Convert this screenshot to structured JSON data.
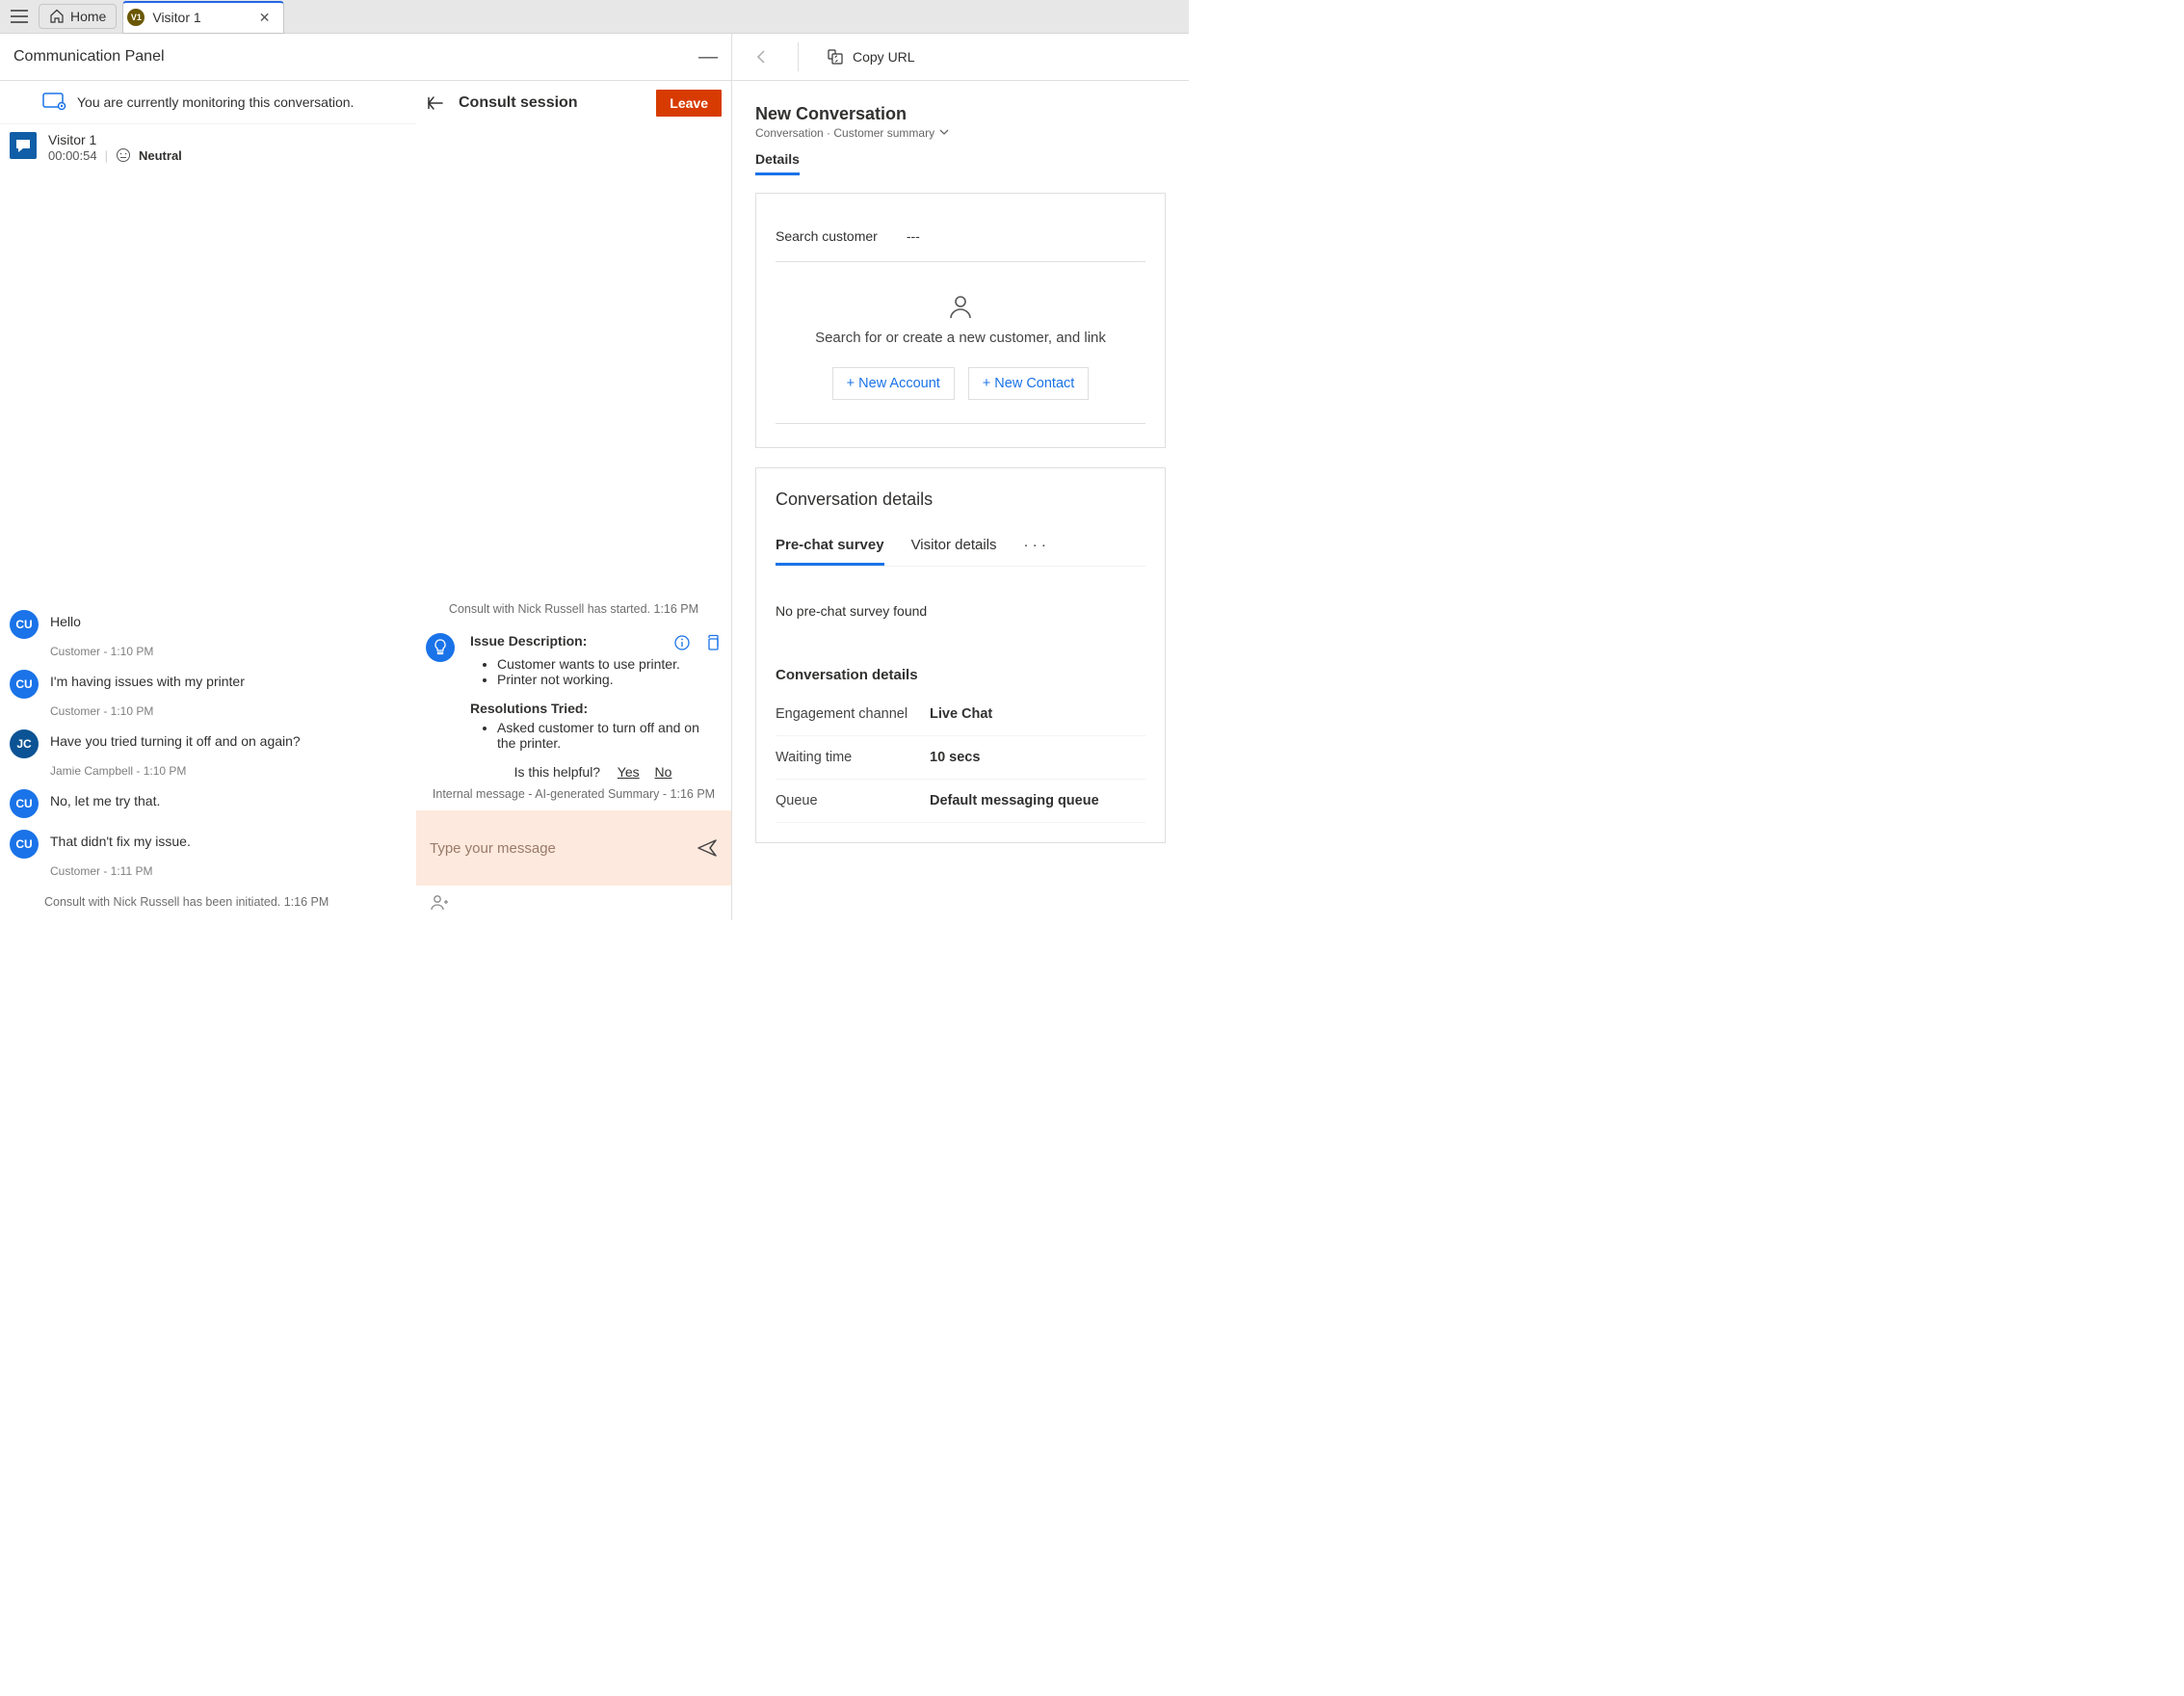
{
  "top": {
    "home_label": "Home",
    "tab_label": "Visitor 1",
    "tab_badge": "V1"
  },
  "comm": {
    "title": "Communication Panel",
    "monitor_msg": "You are currently monitoring this conversation.",
    "consult_title": "Consult session",
    "leave_label": "Leave"
  },
  "session": {
    "name": "Visitor 1",
    "timer": "00:00:54",
    "sentiment": "Neutral"
  },
  "chat": {
    "messages": [
      {
        "avatar": "CU",
        "text": "Hello",
        "meta": "Customer - 1:10 PM"
      },
      {
        "avatar": "CU",
        "text": "I'm having issues with my printer",
        "meta": "Customer - 1:10 PM"
      },
      {
        "avatar": "JC",
        "text": "Have you tried turning it off and on again?",
        "meta": "Jamie Campbell - 1:10 PM"
      },
      {
        "avatar": "CU",
        "text": "No, let me try that.",
        "meta": ""
      },
      {
        "avatar": "CU",
        "text": "That didn't fix my issue.",
        "meta": "Customer - 1:11 PM"
      }
    ],
    "system": "Consult with Nick Russell has been initiated. 1:16 PM"
  },
  "consult": {
    "system_top": "Consult with Nick Russell has started. 1:16 PM",
    "issue_h": "Issue Description:",
    "issues": [
      "Customer wants to use printer.",
      "Printer not working."
    ],
    "res_h": "Resolutions Tried:",
    "resolutions": [
      "Asked customer to turn off and on the printer."
    ],
    "helpful_q": "Is this helpful?",
    "yes": "Yes",
    "no": "No",
    "internal_meta": "Internal message - AI-generated Summary - 1:16 PM",
    "placeholder": "Type your message"
  },
  "right": {
    "copy": "Copy URL",
    "title": "New Conversation",
    "crumb1": "Conversation",
    "crumb2": "Customer summary",
    "details_tab": "Details",
    "search_label": "Search customer",
    "search_val": "---",
    "helper": "Search for or create a new customer, and link",
    "new_account": "+ New Account",
    "new_contact": "+ New Contact",
    "conv_title": "Conversation details",
    "tab_prechat": "Pre-chat survey",
    "tab_visitor": "Visitor details",
    "no_survey": "No pre-chat survey found",
    "section_h": "Conversation details",
    "kv": [
      {
        "k": "Engagement channel",
        "v": "Live Chat"
      },
      {
        "k": "Waiting time",
        "v": "10 secs"
      },
      {
        "k": "Queue",
        "v": "Default messaging queue"
      }
    ]
  }
}
